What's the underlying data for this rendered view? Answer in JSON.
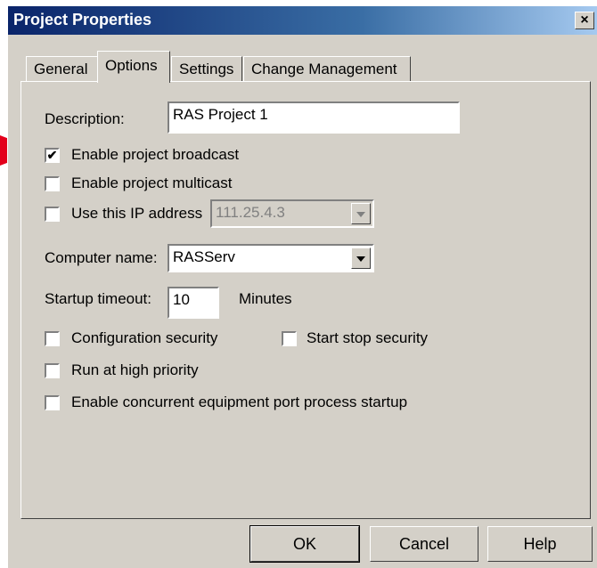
{
  "window": {
    "title": "Project Properties",
    "close_glyph": "×"
  },
  "tabs": [
    "General",
    "Options",
    "Settings",
    "Change Management"
  ],
  "active_tab": "Options",
  "description": {
    "label": "Description:",
    "value": "RAS Project 1"
  },
  "broadcast": {
    "label": "Enable project broadcast",
    "checked": true
  },
  "multicast": {
    "label": "Enable project multicast",
    "checked": false
  },
  "ip": {
    "label": "Use this IP address",
    "checked": false,
    "value": "111.25.4.3"
  },
  "computer": {
    "label": "Computer name:",
    "value": "RASServ"
  },
  "startup": {
    "label": "Startup timeout:",
    "value": "10",
    "unit": "Minutes"
  },
  "config_security": {
    "label": "Configuration security",
    "checked": false
  },
  "startstop_security": {
    "label": "Start stop security",
    "checked": false
  },
  "high_priority": {
    "label": "Run at high priority",
    "checked": false
  },
  "concurrent": {
    "label": "Enable concurrent equipment port process startup",
    "checked": false
  },
  "buttons": {
    "ok": "OK",
    "cancel": "Cancel",
    "help": "Help"
  },
  "colors": {
    "dialog_bg": "#d4d0c8",
    "title_bg": "#0a246a",
    "pointer": "#e3001b"
  },
  "check_glyph": "✔"
}
